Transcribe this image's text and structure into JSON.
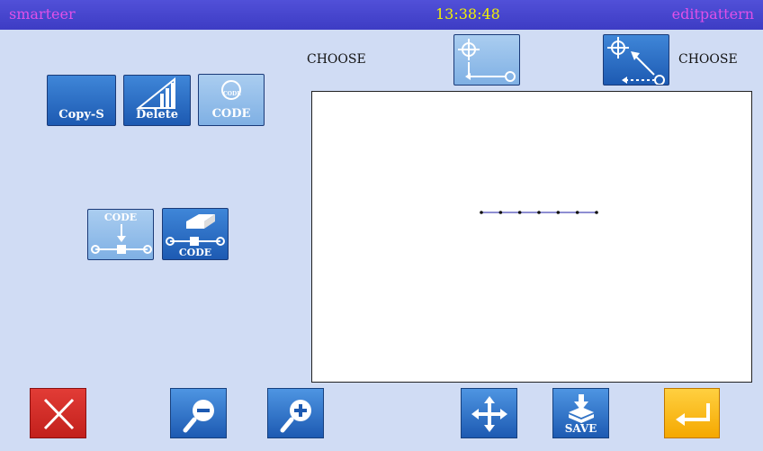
{
  "header": {
    "app_name": "smarteer",
    "clock": "13:38:48",
    "mode": "editpattern"
  },
  "toolbar": {
    "copy_label": "Copy-S",
    "delete_label": "Delete",
    "code_label": "CODE",
    "code_badge": "CODE",
    "insert_code_label": "CODE",
    "edit_code_label": "CODE"
  },
  "choose": {
    "left_label": "CHOOSE",
    "right_label": "CHOOSE"
  },
  "pattern": {
    "stitch_points": 7
  },
  "bottom": {
    "save_label": "SAVE"
  },
  "colors": {
    "accent_red": "#d42a26",
    "accent_yellow": "#f7b500",
    "button_blue": "#2a6ac4"
  }
}
